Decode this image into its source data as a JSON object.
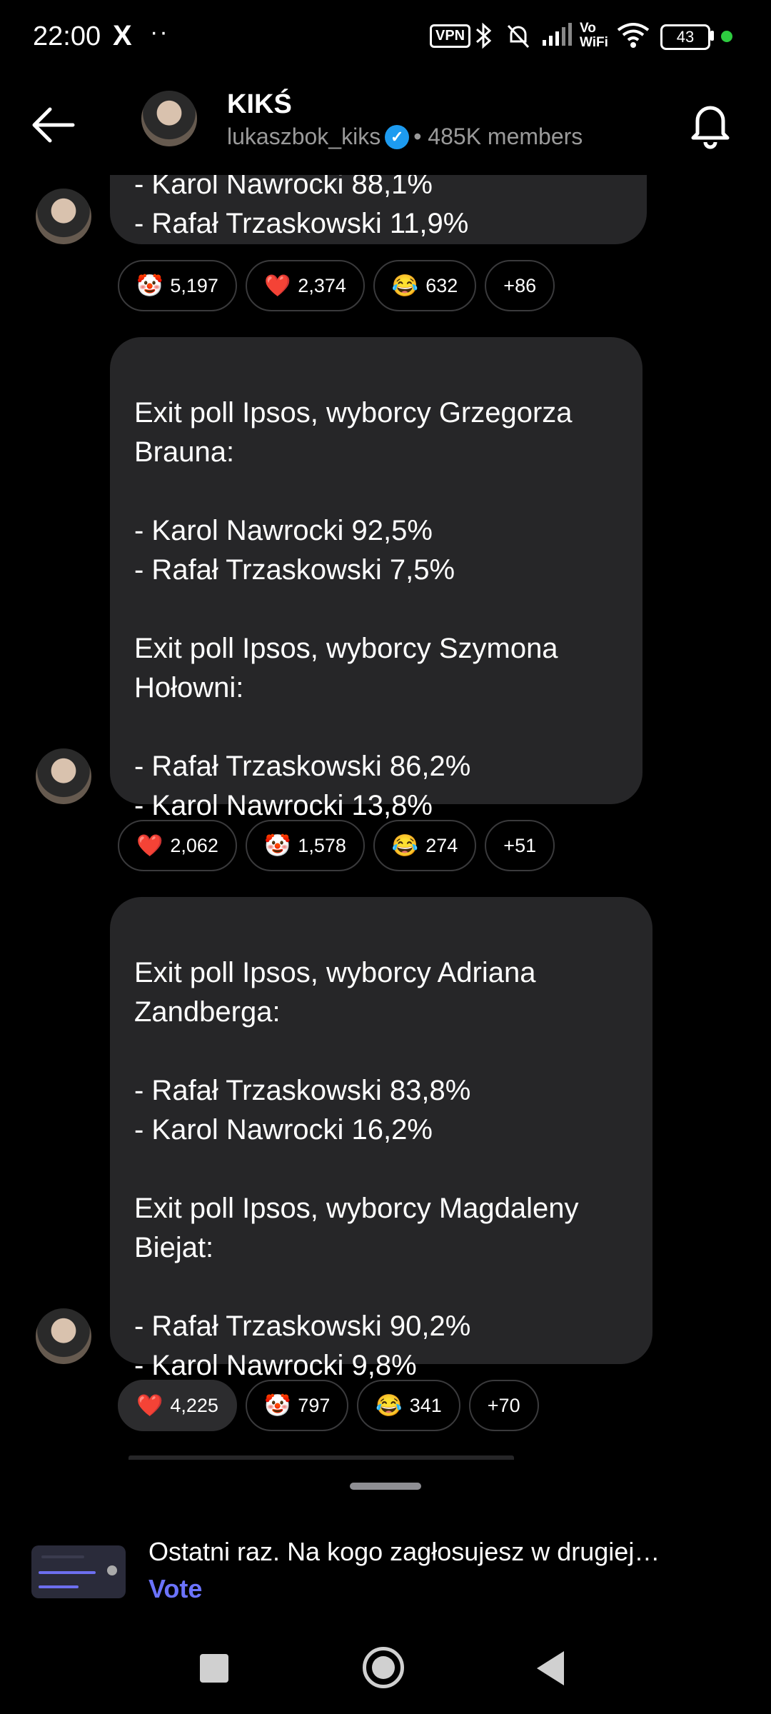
{
  "status_bar": {
    "time": "22:00",
    "x_logo": "X",
    "dots": "··",
    "vpn": "VPN",
    "battery": "43"
  },
  "header": {
    "channel_name": "KIKŚ",
    "username": "lukaszbok_kiks",
    "members": "• 485K members"
  },
  "messages": [
    {
      "text": "- Karol Nawrocki 88,1%\n- Rafał Trzaskowski 11,9%",
      "reactions": [
        {
          "emoji": "🤡",
          "count": "5,197"
        },
        {
          "emoji": "❤️",
          "count": "2,374"
        },
        {
          "emoji": "😂",
          "count": "632"
        },
        {
          "emoji": "",
          "count": "+86"
        }
      ]
    },
    {
      "text": "Exit poll Ipsos, wyborcy Grzegorza Brauna:\n\n- Karol Nawrocki 92,5%\n- Rafał Trzaskowski 7,5%\n\nExit poll Ipsos, wyborcy Szymona Hołowni:\n\n- Rafał Trzaskowski 86,2%\n- Karol Nawrocki 13,8%",
      "reactions": [
        {
          "emoji": "❤️",
          "count": "2,062"
        },
        {
          "emoji": "🤡",
          "count": "1,578"
        },
        {
          "emoji": "😂",
          "count": "274"
        },
        {
          "emoji": "",
          "count": "+51"
        }
      ]
    },
    {
      "text": "Exit poll Ipsos, wyborcy Adriana Zandberga:\n\n- Rafał Trzaskowski 83,8%\n- Karol Nawrocki 16,2%\n\nExit poll Ipsos, wyborcy Magdaleny Biejat:\n\n- Rafał Trzaskowski 90,2%\n- Karol Nawrocki 9,8%",
      "reactions": [
        {
          "emoji": "❤️",
          "count": "4,225"
        },
        {
          "emoji": "🤡",
          "count": "797"
        },
        {
          "emoji": "😂",
          "count": "341"
        },
        {
          "emoji": "",
          "count": "+70"
        }
      ]
    }
  ],
  "poll": {
    "title": "Ostatni raz. Na kogo zagłosujesz w drugiej…",
    "vote_label": "Vote"
  },
  "colors": {
    "background": "#000000",
    "bubble": "#262628",
    "accent": "#6b73ff",
    "verified": "#1d9bf0"
  }
}
